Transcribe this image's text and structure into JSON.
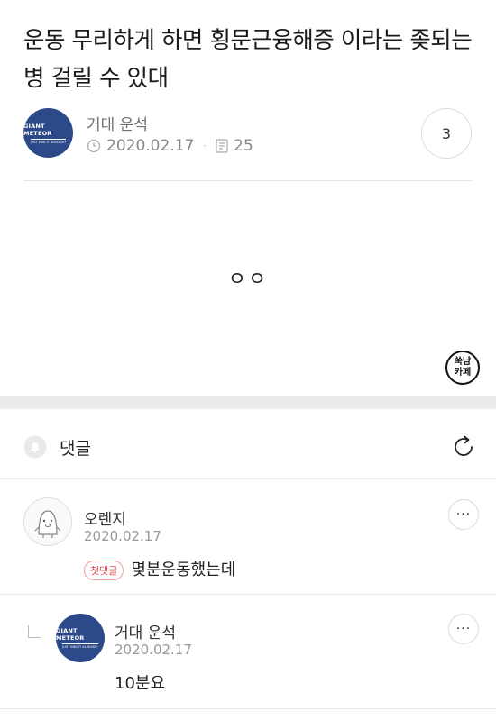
{
  "post": {
    "title": "운동 무리하게 하면 횡문근융해증 이라는 좆되는 병 걸릴 수 있대",
    "author": "거대 운석",
    "date": "2020.02.17",
    "views": "25",
    "comment_count": "3",
    "body": "ㅇㅇ",
    "stamp_line1": "쑥남",
    "stamp_line2": "카페"
  },
  "avatar": {
    "brand": "GIANT METEOR",
    "tagline": "JUST END IT ALREADY!"
  },
  "comments_section": {
    "label": "댓글"
  },
  "comments": [
    {
      "author": "오렌지",
      "date": "2020.02.17",
      "badge": "첫댓글",
      "text": "몇분운동했는데"
    },
    {
      "author": "거대 운석",
      "date": "2020.02.17",
      "text": "10분요"
    }
  ],
  "more_label": "···",
  "colors": {
    "avatar_bg": "#2c4a8a",
    "badge_red": "#e5484d",
    "divider": "#ebebeb"
  }
}
